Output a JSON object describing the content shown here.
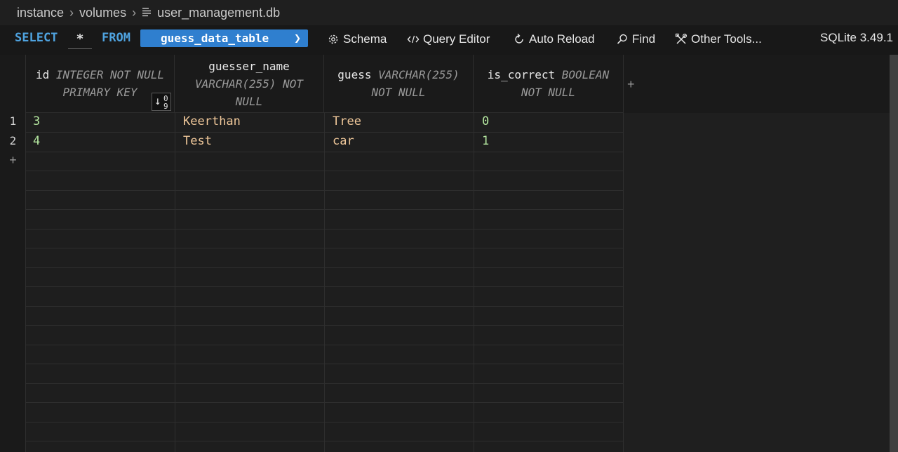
{
  "breadcrumb": {
    "items": [
      "instance",
      "volumes",
      "user_management.db"
    ]
  },
  "query": {
    "select_kw": "SELECT",
    "columns": "*",
    "from_kw": "FROM",
    "table": "guess_data_table"
  },
  "toolbar": {
    "schema": "Schema",
    "query_editor": "Query Editor",
    "auto_reload": "Auto Reload",
    "find": "Find",
    "other_tools": "Other Tools...",
    "version": "SQLite 3.49.1"
  },
  "columns": [
    {
      "name": "id",
      "type_a": "INTEGER NOT NULL",
      "type_b": "PRIMARY KEY"
    },
    {
      "name": "guesser_name",
      "type_a": "VARCHAR(255) NOT",
      "type_b": "NULL"
    },
    {
      "name": "guess",
      "type_a": "VARCHAR(255)",
      "type_b": "NOT NULL"
    },
    {
      "name": "is_correct",
      "type_a": "BOOLEAN",
      "type_b": "NOT NULL"
    }
  ],
  "sort_badge": {
    "top": "0",
    "bottom": "9"
  },
  "rows": [
    {
      "num": "1",
      "id": "3",
      "guesser_name": "Keerthan",
      "guess": "Tree",
      "is_correct": "0"
    },
    {
      "num": "2",
      "id": "4",
      "guesser_name": "Test",
      "guess": "car",
      "is_correct": "1"
    }
  ],
  "add_glyph": "+",
  "colors": {
    "keyword": "#4fa3e0",
    "table_pill": "#2f7fcf",
    "number": "#b5e8a0",
    "string": "#f0c89a"
  }
}
